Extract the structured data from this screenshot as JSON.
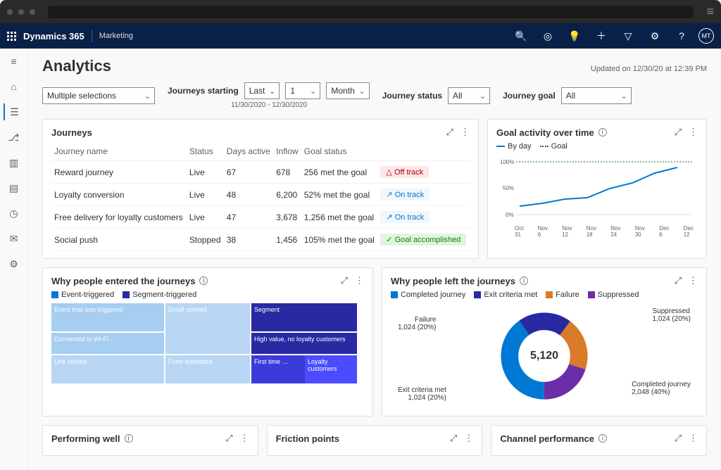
{
  "topbar": {
    "brand": "Dynamics 365",
    "module": "Marketing",
    "avatar": "MT"
  },
  "page": {
    "title": "Analytics",
    "updated": "Updated on 12/30/20 at 12:39 PM"
  },
  "filters": {
    "selector_value": "Multiple selections",
    "journeys_starting_label": "Journeys starting",
    "last": "Last",
    "count": "1",
    "unit": "Month",
    "range": "11/30/2020 - 12/30/2020",
    "status_label": "Journey status",
    "status_value": "All",
    "goal_label": "Journey goal",
    "goal_value": "All"
  },
  "journeys_card": {
    "title": "Journeys",
    "columns": [
      "Journey name",
      "Status",
      "Days active",
      "Inflow",
      "Goal status",
      ""
    ],
    "rows": [
      {
        "name": "Reward journey",
        "status": "Live",
        "days": "67",
        "inflow": "678",
        "goal": "256 met the goal",
        "badge": "Off track",
        "badge_class": "badge-off",
        "badge_icon": "△"
      },
      {
        "name": "Loyalty conversion",
        "status": "Live",
        "days": "48",
        "inflow": "6,200",
        "goal": "52% met the goal",
        "badge": "On track",
        "badge_class": "badge-on",
        "badge_icon": "↗"
      },
      {
        "name": "Free delivery for loyalty customers",
        "status": "Live",
        "days": "47",
        "inflow": "3,678",
        "goal": "1,256 met the goal",
        "badge": "On track",
        "badge_class": "badge-on",
        "badge_icon": "↗"
      },
      {
        "name": "Social push",
        "status": "Stopped",
        "days": "38",
        "inflow": "1,456",
        "goal": "105% met the goal",
        "badge": "Goal accomplished",
        "badge_class": "badge-done",
        "badge_icon": "✓"
      }
    ]
  },
  "goal_activity": {
    "title": "Goal activity over time",
    "legend": [
      "By day",
      "Goal"
    ]
  },
  "entered": {
    "title": "Why people entered the journeys",
    "legend": [
      "Event-triggered",
      "Segment-triggered"
    ],
    "tiles": {
      "event_label": "Event that was triggered",
      "wifi": "Connected to Wi-Fi",
      "email": "Email opened",
      "link": "Link clicked",
      "form": "Form submitted",
      "segment": "Segment",
      "high_value": "High value, no loyalty customers",
      "first": "First time …",
      "loyalty": "Loyalty customers"
    }
  },
  "left": {
    "title": "Why people left the journeys",
    "legend": [
      "Completed journey",
      "Exit criteria met",
      "Failure",
      "Suppressed"
    ],
    "total": "5,120",
    "labels": {
      "failure": "Failure",
      "failure_v": "1,024 (20%)",
      "suppressed": "Suppressed",
      "suppressed_v": "1,024 (20%)",
      "exit": "Exit criteria met",
      "exit_v": "1,024 (20%)",
      "completed": "Completed journey",
      "completed_v": "2,048 (40%)"
    }
  },
  "row3": {
    "perf": "Performing well",
    "friction": "Friction points",
    "channel": "Channel performance"
  },
  "chart_data": [
    {
      "type": "line",
      "title": "Goal activity over time",
      "categories": [
        "Oct 31",
        "Nov 6",
        "Nov 12",
        "Nov 18",
        "Nov 24",
        "Nov 30",
        "Dec 6",
        "Dec 12"
      ],
      "series": [
        {
          "name": "By day",
          "values": [
            18,
            23,
            30,
            32,
            50,
            60,
            78,
            90
          ]
        },
        {
          "name": "Goal",
          "values": [
            100,
            100,
            100,
            100,
            100,
            100,
            100,
            100
          ]
        }
      ],
      "ylabel": "%",
      "ylim": [
        0,
        100
      ]
    },
    {
      "type": "pie",
      "title": "Why people left the journeys",
      "categories": [
        "Completed journey",
        "Exit criteria met",
        "Failure",
        "Suppressed"
      ],
      "values": [
        2048,
        1024,
        1024,
        1024
      ],
      "total": 5120
    }
  ]
}
